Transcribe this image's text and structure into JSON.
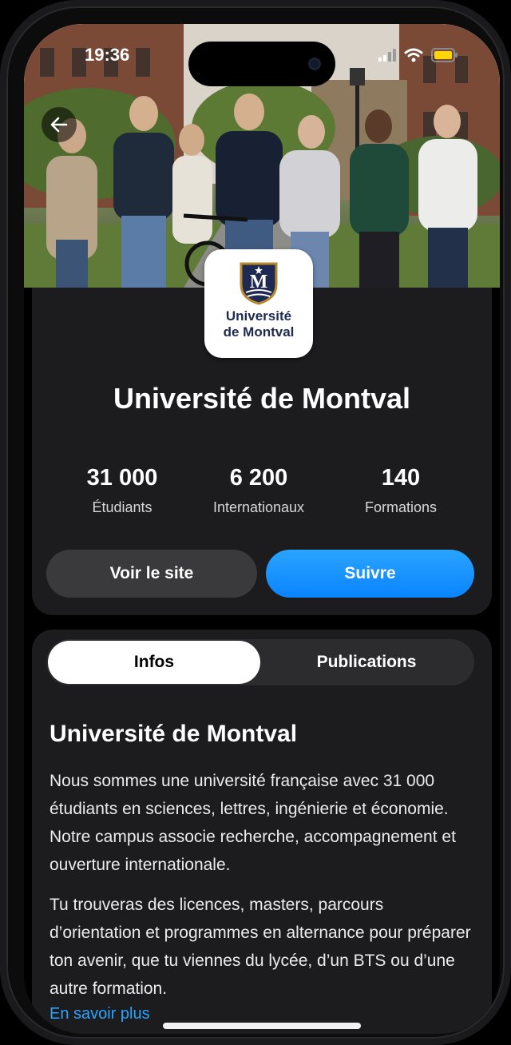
{
  "status_bar": {
    "time": "19:36"
  },
  "hero": {
    "alt": "students walking on campus"
  },
  "university": {
    "name": "Université de Montval",
    "logo_letter": "M",
    "logo_line1": "Université",
    "logo_line2": "de Montval"
  },
  "stats": [
    {
      "value": "31 000",
      "label": "Étudiants"
    },
    {
      "value": "6 200",
      "label": "Internationaux"
    },
    {
      "value": "140",
      "label": "Formations"
    }
  ],
  "actions": {
    "site_label": "Voir le site",
    "follow_label": "Suivre"
  },
  "tabs": {
    "infos": "Infos",
    "publications": "Publications",
    "selected": "Infos"
  },
  "info": {
    "title": "Université de Montval",
    "paragraph1": "Nous sommes une université française avec 31 000 étudiants en sciences, lettres, ingénierie et économie. Notre campus associe recherche, accompagnement et ouverture internationale.",
    "paragraph2": "Tu trouveras des licences, masters, parcours d’orientation et programmes en alternance pour préparer ton avenir, que tu viennes du lycée, d’un BTS ou d’une autre formation.",
    "more_link": "En savoir plus"
  },
  "colors": {
    "accent": "#0A84FF",
    "card_bg": "#1C1C1E",
    "logo_navy": "#1F2A52"
  },
  "icons": {
    "back": "arrow-left-icon",
    "signal": "signal-icon",
    "wifi": "wifi-icon",
    "battery": "battery-icon"
  }
}
